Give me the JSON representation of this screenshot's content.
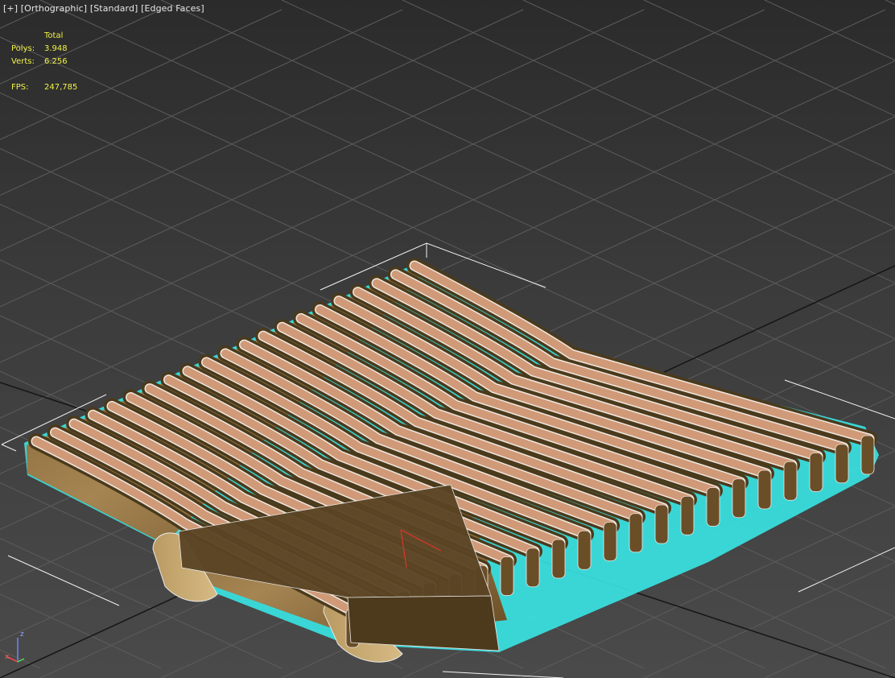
{
  "viewport": {
    "labels": {
      "plus": "[+]",
      "view": "[Orthographic]",
      "shading": "[Standard]",
      "mode": "[Edged Faces]"
    },
    "stats": {
      "header": "Total",
      "polys_label": "Polys:",
      "polys_value": "3.948",
      "verts_label": "Verts:",
      "verts_value": "6.256",
      "fps_label": "FPS:",
      "fps_value": "247,785"
    },
    "gizmo": {
      "z": "z",
      "x": "x"
    },
    "colors": {
      "background": "#3a3a3a",
      "grid": "#5a5a5a",
      "grid_dark": "#111111",
      "stats_text": "#f2f24a",
      "selection": "#39e6e6",
      "slat_top": "#d09a78",
      "slat_side": "#5a4424",
      "wood": "#8a6a3a"
    }
  }
}
